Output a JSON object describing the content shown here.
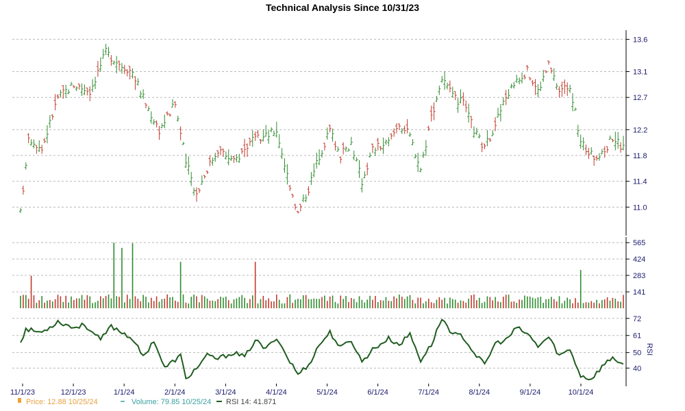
{
  "chart_data": {
    "type": "ohlc",
    "title": "Technical Analysis Since 10/31/23",
    "colors": {
      "up": "#2e8b2e",
      "down": "#c0392b",
      "rsi": "#1f5c1f",
      "price_legend": "#f0a030",
      "volume_legend": "#3aa0a0"
    },
    "x_tick_labels": [
      "11/1/23",
      "12/1/23",
      "1/1/24",
      "2/1/24",
      "3/1/24",
      "4/1/24",
      "5/1/24",
      "6/1/24",
      "7/1/24",
      "8/1/24",
      "9/1/24",
      "10/1/24"
    ],
    "price": {
      "ylim": [
        10.6,
        13.7
      ],
      "ticks": [
        "13.6",
        "13.1",
        "12.7",
        "12.2",
        "11.8",
        "11.4",
        "11.0"
      ],
      "anchors": [
        [
          0,
          10.9
        ],
        [
          3,
          12.1
        ],
        [
          8,
          11.9
        ],
        [
          14,
          12.7
        ],
        [
          20,
          12.9
        ],
        [
          26,
          12.8
        ],
        [
          32,
          13.4
        ],
        [
          38,
          13.2
        ],
        [
          42,
          13.1
        ],
        [
          47,
          12.6
        ],
        [
          52,
          12.2
        ],
        [
          58,
          12.6
        ],
        [
          62,
          11.7
        ],
        [
          66,
          11.2
        ],
        [
          70,
          11.6
        ],
        [
          74,
          11.9
        ],
        [
          80,
          11.7
        ],
        [
          86,
          12.0
        ],
        [
          92,
          12.1
        ],
        [
          96,
          12.2
        ],
        [
          100,
          11.5
        ],
        [
          104,
          10.9
        ],
        [
          108,
          11.3
        ],
        [
          112,
          11.8
        ],
        [
          116,
          12.2
        ],
        [
          120,
          11.8
        ],
        [
          124,
          12.0
        ],
        [
          128,
          11.4
        ],
        [
          132,
          11.9
        ],
        [
          138,
          12.0
        ],
        [
          142,
          12.3
        ],
        [
          146,
          12.1
        ],
        [
          150,
          11.6
        ],
        [
          154,
          12.4
        ],
        [
          158,
          13.0
        ],
        [
          162,
          12.7
        ],
        [
          166,
          12.6
        ],
        [
          170,
          12.2
        ],
        [
          174,
          11.9
        ],
        [
          178,
          12.3
        ],
        [
          182,
          12.7
        ],
        [
          186,
          13.0
        ],
        [
          190,
          13.1
        ],
        [
          194,
          12.8
        ],
        [
          198,
          13.2
        ],
        [
          202,
          12.8
        ],
        [
          206,
          12.9
        ],
        [
          210,
          12.0
        ],
        [
          214,
          11.8
        ],
        [
          218,
          11.8
        ],
        [
          222,
          12.1
        ],
        [
          226,
          11.9
        ]
      ]
    },
    "volume": {
      "ylim": [
        0,
        590
      ],
      "ticks": [
        "565",
        "424",
        "283",
        "141"
      ],
      "spikes": [
        [
          4,
          280
        ],
        [
          35,
          565
        ],
        [
          38,
          520
        ],
        [
          42,
          560
        ],
        [
          60,
          400
        ],
        [
          88,
          400
        ],
        [
          210,
          330
        ]
      ]
    },
    "rsi": {
      "ylim": [
        30,
        75
      ],
      "ticks": [
        "72",
        "61",
        "50",
        "40"
      ],
      "axis_label": "RSI",
      "anchors": [
        [
          0,
          57
        ],
        [
          2,
          65
        ],
        [
          8,
          63
        ],
        [
          14,
          70
        ],
        [
          20,
          66
        ],
        [
          24,
          68
        ],
        [
          30,
          58
        ],
        [
          34,
          67
        ],
        [
          38,
          63
        ],
        [
          42,
          59
        ],
        [
          46,
          47
        ],
        [
          50,
          58
        ],
        [
          54,
          40
        ],
        [
          60,
          48
        ],
        [
          62,
          33
        ],
        [
          66,
          40
        ],
        [
          70,
          48
        ],
        [
          74,
          46
        ],
        [
          80,
          50
        ],
        [
          84,
          47
        ],
        [
          88,
          58
        ],
        [
          92,
          52
        ],
        [
          96,
          60
        ],
        [
          100,
          47
        ],
        [
          104,
          36
        ],
        [
          108,
          42
        ],
        [
          112,
          55
        ],
        [
          116,
          63
        ],
        [
          120,
          53
        ],
        [
          124,
          58
        ],
        [
          128,
          44
        ],
        [
          132,
          52
        ],
        [
          138,
          59
        ],
        [
          142,
          55
        ],
        [
          146,
          62
        ],
        [
          150,
          45
        ],
        [
          154,
          55
        ],
        [
          158,
          72
        ],
        [
          162,
          62
        ],
        [
          166,
          60
        ],
        [
          170,
          50
        ],
        [
          174,
          42
        ],
        [
          178,
          56
        ],
        [
          182,
          58
        ],
        [
          186,
          66
        ],
        [
          190,
          62
        ],
        [
          194,
          54
        ],
        [
          198,
          60
        ],
        [
          202,
          48
        ],
        [
          206,
          52
        ],
        [
          210,
          35
        ],
        [
          214,
          33
        ],
        [
          218,
          41
        ],
        [
          222,
          47
        ],
        [
          226,
          42
        ]
      ]
    },
    "n_bars": 227,
    "legend": {
      "price": "Price: 12.88  10/25/24",
      "volume": "Volume: 79.85  10/25/24",
      "rsi": "RSI 14: 41.871"
    }
  }
}
